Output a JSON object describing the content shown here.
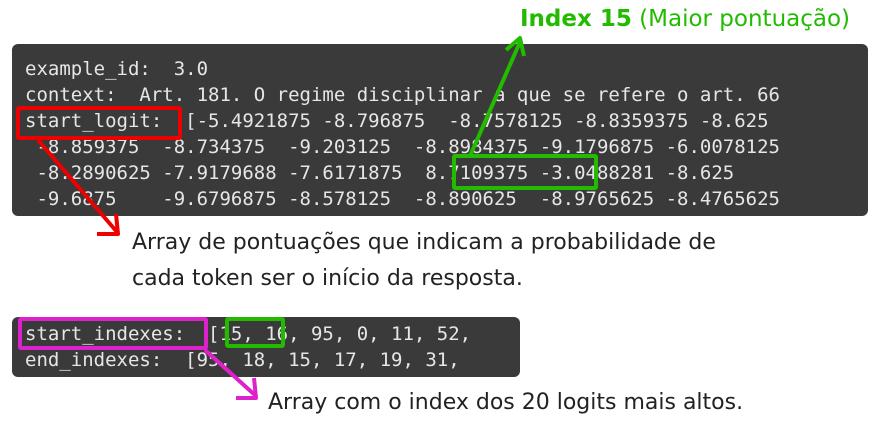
{
  "annotation_title": {
    "bold": "Index 15",
    "rest": " (Maior pontuação)",
    "color": "#22bb00"
  },
  "terminal1": {
    "lines": [
      "example_id:  3.0",
      "context:  Art. 181. O regime disciplinar a que se refere o art. 66",
      "start_logit:  [-5.4921875 -8.796875  -8.7578125 -8.8359375 -8.625",
      " -8.859375  -8.734375  -9.203125  -8.8984375 -9.1796875 -6.0078125",
      " -8.2890625 -7.9179688 -7.6171875  8.7109375 -3.0488281 -8.625",
      " -9.6875    -9.6796875 -8.578125  -8.890625  -8.9765625 -8.4765625"
    ]
  },
  "caption1": {
    "line1": "Array de pontuações que indicam a probabilidade de",
    "line2": "cada token ser o início da resposta."
  },
  "terminal2": {
    "lines": [
      "start_indexes:  [15, 16, 95, 0, 11, 52,",
      "end_indexes:  [95, 18, 15, 17, 19, 31,"
    ]
  },
  "caption2": {
    "line1": "Array com o index dos 20 logits mais altos."
  },
  "colors": {
    "red": "#ee0000",
    "green": "#22bb00",
    "magenta": "#dd22cc",
    "terminal_bg": "#3a3a3a"
  }
}
